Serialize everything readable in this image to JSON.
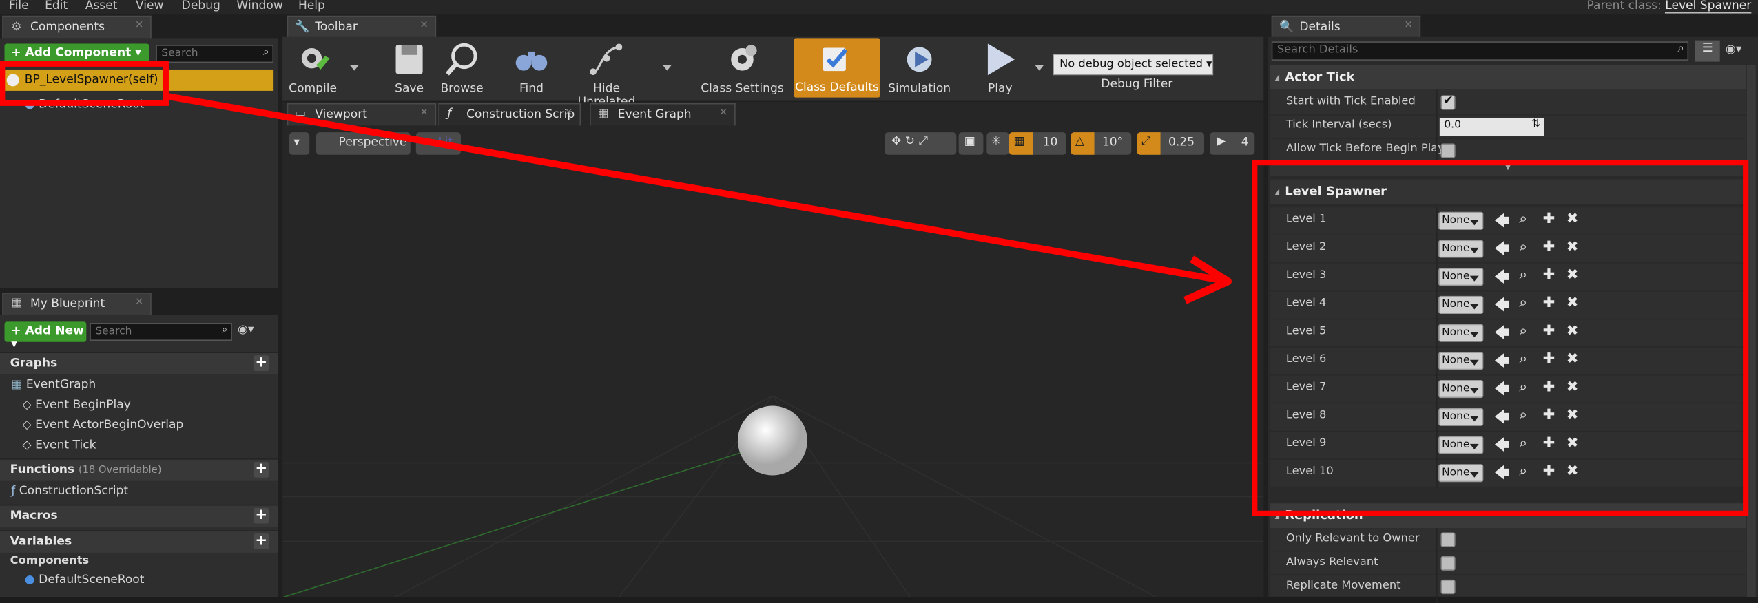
{
  "menu": [
    "File",
    "Edit",
    "Asset",
    "View",
    "Debug",
    "Window",
    "Help"
  ],
  "parent_class": {
    "label": "Parent class:",
    "value": "Level Spawner"
  },
  "components_panel": {
    "tab": "Components",
    "add_label": "+ Add Component ▾",
    "search_placeholder": "Search",
    "items": [
      {
        "label": "BP_LevelSpawner(self)"
      },
      {
        "label": "DefaultSceneRoot"
      }
    ]
  },
  "my_blueprint": {
    "tab": "My Blueprint",
    "add_label": "Add New",
    "search_placeholder": "Search",
    "graphs_label": "Graphs",
    "graph_items": [
      "EventGraph",
      "Event BeginPlay",
      "Event ActorBeginOverlap",
      "Event Tick"
    ],
    "functions_label": "Functions",
    "functions_note": "(18 Overridable)",
    "function_items": [
      "ConstructionScript"
    ],
    "macros_label": "Macros",
    "variables_label": "Variables",
    "components_label": "Components",
    "component_items": [
      "DefaultSceneRoot"
    ]
  },
  "toolbar": {
    "tab": "Toolbar",
    "buttons": [
      "Compile",
      "Save",
      "Browse",
      "Find",
      "Hide Unrelated",
      "Class Settings",
      "Class Defaults",
      "Simulation",
      "Play"
    ],
    "debug_select": "No debug object selected",
    "debug_filter": "Debug Filter"
  },
  "editor_tabs": [
    "Viewport",
    "Construction Scrip",
    "Event Graph"
  ],
  "viewport": {
    "perspective": "Perspective",
    "lit": "Lit",
    "grid_snap": "10",
    "rot_snap": "10°",
    "scale_snap": "0.25",
    "cam_speed": "4"
  },
  "details": {
    "tab": "Details",
    "search_placeholder": "Search Details",
    "actor_tick": {
      "header": "Actor Tick",
      "rows": [
        {
          "label": "Start with Tick Enabled",
          "checked": true
        },
        {
          "label": "Tick Interval (secs)",
          "value": "0.0"
        },
        {
          "label": "Allow Tick Before Begin Play",
          "checked": false
        }
      ]
    },
    "level_spawner": {
      "header": "Level Spawner",
      "none_label": "None",
      "levels": [
        "Level 1",
        "Level 2",
        "Level 3",
        "Level 4",
        "Level 5",
        "Level 6",
        "Level 7",
        "Level 8",
        "Level 9",
        "Level 10"
      ]
    },
    "replication": {
      "header": "Replication",
      "rows": [
        "Only Relevant to Owner",
        "Always Relevant",
        "Replicate Movement"
      ]
    }
  },
  "colors": {
    "annotation": "#ff0000",
    "class_defaults": "#d38a1a",
    "selected_component": "#d4a017",
    "add_green": "#3c9a2c"
  }
}
